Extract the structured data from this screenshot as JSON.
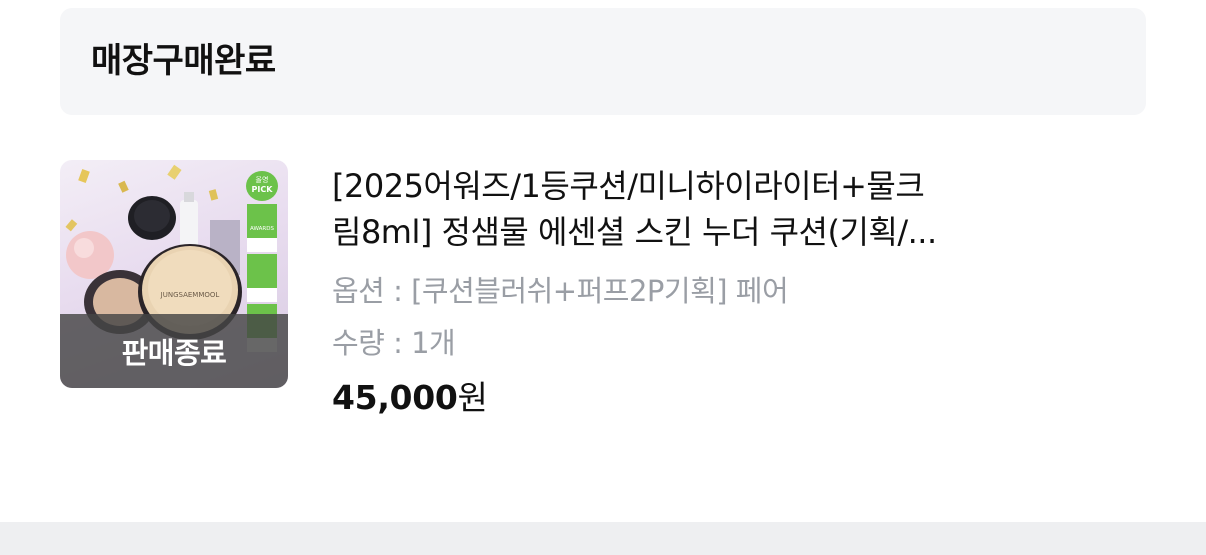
{
  "header": {
    "title": "매장구매완료"
  },
  "product": {
    "name_line1": "[2025어워즈/1등쿠션/미니하이라이터+물크",
    "name_line2": "림8ml] 정샘물 에센셜 스킨 누더 쿠션(기획/...",
    "option_label": "옵션 :",
    "option_value": "[쿠션블러쉬+퍼프2P기획] 페어",
    "quantity_label": "수량 :",
    "quantity_value": "1개",
    "price": "45,000",
    "price_unit": "원",
    "status_badge": "판매종료",
    "image_badge_top": "올영",
    "image_badge_pick": "PICK",
    "image_award_text": "AWARDS",
    "image_brand_text": "JUNGSAEMMOOL"
  },
  "colors": {
    "accent_green": "#6cc24a",
    "muted_text": "#9a9ea5",
    "header_bg": "#f5f6f8"
  }
}
